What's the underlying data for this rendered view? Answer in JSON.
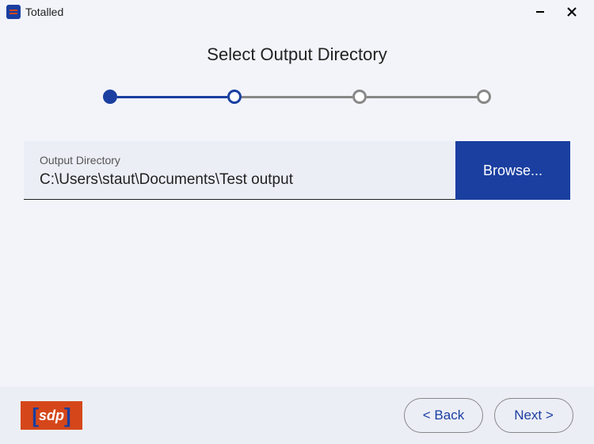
{
  "window": {
    "title": "Totalled"
  },
  "page": {
    "heading": "Select Output Directory"
  },
  "stepper": {
    "steps": 4,
    "current": 2
  },
  "field": {
    "label": "Output Directory",
    "value": "C:\\Users\\staut\\Documents\\Test output"
  },
  "buttons": {
    "browse": "Browse...",
    "back": "< Back",
    "next": "Next >"
  },
  "logo": {
    "text": "sdp"
  },
  "colors": {
    "primary": "#1a3fa0",
    "accent": "#d5471a",
    "bg": "#f3f4fa",
    "panel": "#eceef6"
  }
}
